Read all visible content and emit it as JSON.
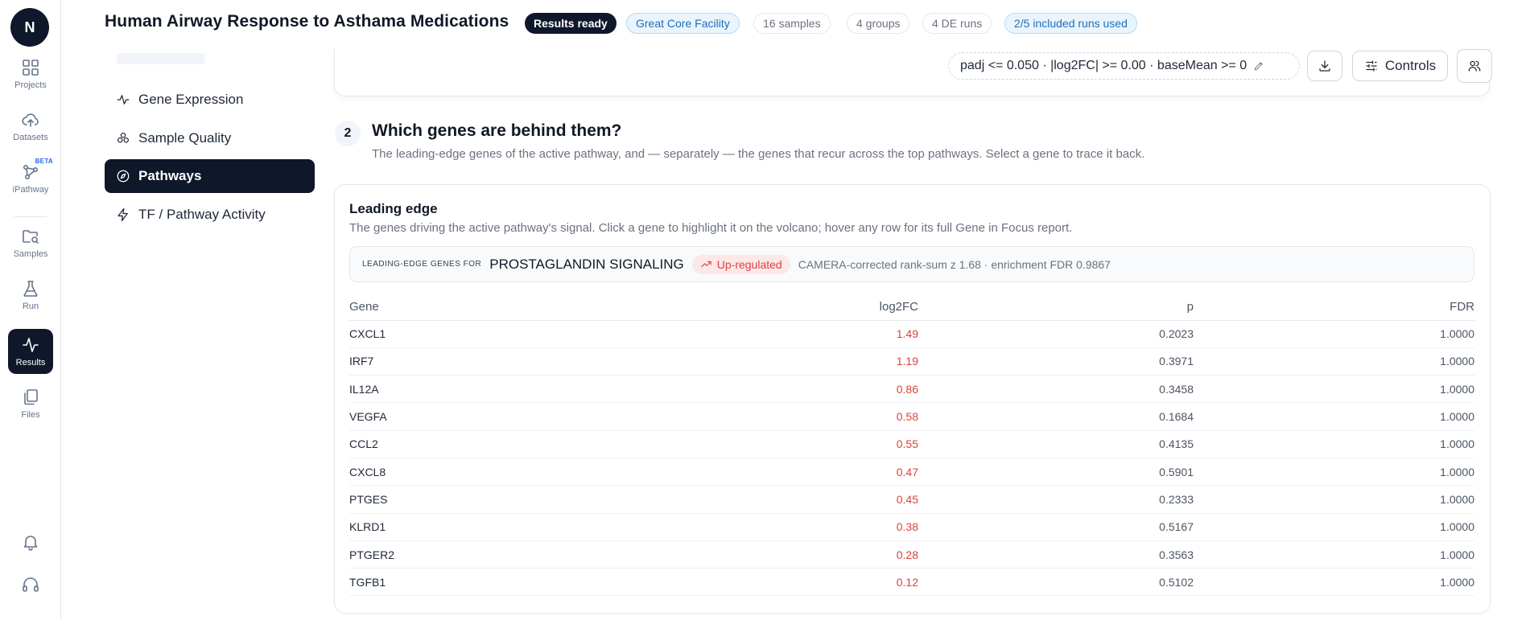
{
  "app": {
    "logo_letter": "N"
  },
  "rail": {
    "items": [
      {
        "key": "projects",
        "label": "Projects",
        "icon": "grid-icon"
      },
      {
        "key": "datasets",
        "label": "Datasets",
        "icon": "cloud-upload-icon"
      },
      {
        "key": "ipathway",
        "label": "iPathway",
        "icon": "network-icon",
        "badge": "BETA"
      },
      {
        "key": "samples",
        "label": "Samples",
        "icon": "folder-search-icon"
      },
      {
        "key": "run",
        "label": "Run",
        "icon": "flask-icon"
      },
      {
        "key": "results",
        "label": "Results",
        "icon": "activity-icon",
        "active": true
      },
      {
        "key": "files",
        "label": "Files",
        "icon": "files-icon"
      }
    ],
    "bottom": [
      "bell-icon",
      "headset-icon"
    ]
  },
  "header": {
    "title": "Human Airway Response to Asthama Medications",
    "pills": {
      "status": "Results ready",
      "facility": "Great Core Facility",
      "samples": "16 samples",
      "groups": "4 groups",
      "de_runs": "4 DE runs",
      "runs_used": "2/5 included runs used"
    },
    "filter": "padj <= 0.050 · |log2FC| >= 0.00 · baseMean >= 0",
    "controls_label": "Controls"
  },
  "subnav": {
    "items": [
      {
        "label": "Gene Expression",
        "icon": "pulse-icon"
      },
      {
        "label": "Sample Quality",
        "icon": "circles-icon"
      },
      {
        "label": "Pathways",
        "icon": "compass-icon",
        "active": true
      },
      {
        "label": "TF / Pathway Activity",
        "icon": "bolt-icon"
      }
    ]
  },
  "step": {
    "number": "2",
    "title": "Which genes are behind them?",
    "description": "The leading-edge genes of the active pathway, and — separately — the genes that recur across the top pathways. Select a gene to trace it back."
  },
  "leading_edge": {
    "title": "Leading edge",
    "description": "The genes driving the active pathway's signal. Click a gene to highlight it on the volcano; hover any row for its full Gene in Focus report.",
    "bar_label": "Leading-edge genes for",
    "pathway": "PROSTAGLANDIN SIGNALING",
    "direction": "Up-regulated",
    "stats": "CAMERA-corrected rank-sum z 1.68 · enrichment FDR 0.9867",
    "columns": {
      "gene": "Gene",
      "log2fc": "log2FC",
      "p": "p",
      "fdr": "FDR"
    },
    "rows": [
      {
        "gene": "CXCL1",
        "log2fc": "1.49",
        "p": "0.2023",
        "fdr": "1.0000"
      },
      {
        "gene": "IRF7",
        "log2fc": "1.19",
        "p": "0.3971",
        "fdr": "1.0000"
      },
      {
        "gene": "IL12A",
        "log2fc": "0.86",
        "p": "0.3458",
        "fdr": "1.0000"
      },
      {
        "gene": "VEGFA",
        "log2fc": "0.58",
        "p": "0.1684",
        "fdr": "1.0000"
      },
      {
        "gene": "CCL2",
        "log2fc": "0.55",
        "p": "0.4135",
        "fdr": "1.0000"
      },
      {
        "gene": "CXCL8",
        "log2fc": "0.47",
        "p": "0.5901",
        "fdr": "1.0000"
      },
      {
        "gene": "PTGES",
        "log2fc": "0.45",
        "p": "0.2333",
        "fdr": "1.0000"
      },
      {
        "gene": "KLRD1",
        "log2fc": "0.38",
        "p": "0.5167",
        "fdr": "1.0000"
      },
      {
        "gene": "PTGER2",
        "log2fc": "0.28",
        "p": "0.3563",
        "fdr": "1.0000"
      },
      {
        "gene": "TGFB1",
        "log2fc": "0.12",
        "p": "0.5102",
        "fdr": "1.0000"
      }
    ]
  }
}
